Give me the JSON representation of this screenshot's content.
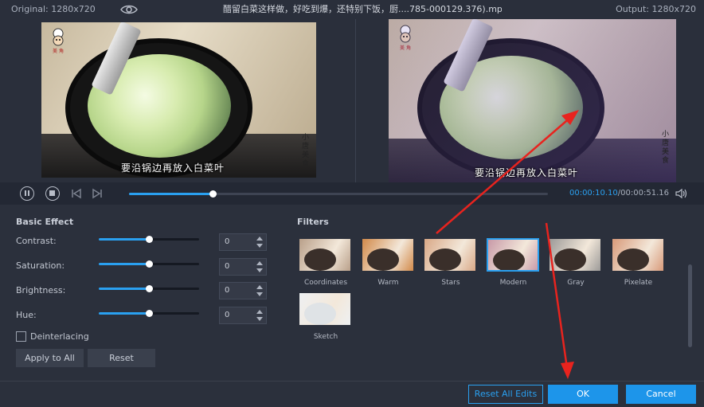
{
  "header": {
    "original_label": "Original: 1280x720",
    "output_label": "Output: 1280x720",
    "file_title": "醋留白菜这样做，好吃到爆，还特别下饭，厨....785-000129.376).mp4"
  },
  "video": {
    "caption": "要沿锅边再放入白菜叶",
    "watermark_vertical": "小唐美食",
    "logo_label": "美 角"
  },
  "playback": {
    "current_time": "00:00:10.10",
    "separator": "/",
    "total_time": "00:00:51.16",
    "progress_fraction": 0.2
  },
  "basic_effect": {
    "title": "Basic Effect",
    "rows": [
      {
        "label": "Contrast:",
        "value": "0",
        "level": 0.5
      },
      {
        "label": "Saturation:",
        "value": "0",
        "level": 0.5
      },
      {
        "label": "Brightness:",
        "value": "0",
        "level": 0.5
      },
      {
        "label": "Hue:",
        "value": "0",
        "level": 0.5
      }
    ],
    "deinterlacing_label": "Deinterlacing",
    "deinterlacing_checked": false,
    "apply_all_label": "Apply to All",
    "reset_label": "Reset"
  },
  "filters": {
    "title": "Filters",
    "items": [
      {
        "name": "Coordinates",
        "selected": false,
        "tone": "#b9a08a"
      },
      {
        "name": "Warm",
        "selected": false,
        "tone": "#d28a4a"
      },
      {
        "name": "Stars",
        "selected": false,
        "tone": "#d9a887"
      },
      {
        "name": "Modern",
        "selected": true,
        "tone": "#c89aa8"
      },
      {
        "name": "Gray",
        "selected": false,
        "tone": "#9c9a98"
      },
      {
        "name": "Pixelate",
        "selected": false,
        "tone": "#d89a7a"
      },
      {
        "name": "Sketch",
        "selected": false,
        "tone": "#eef0f2"
      }
    ]
  },
  "footer": {
    "reset_all_label": "Reset All Edits",
    "ok_label": "OK",
    "cancel_label": "Cancel"
  },
  "colors": {
    "accent": "#2aa0f0",
    "annotation_arrow": "#e8231e",
    "background": "#2b303c"
  }
}
